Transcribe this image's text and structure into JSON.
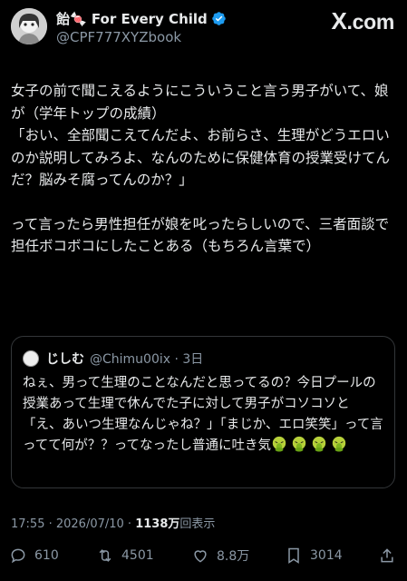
{
  "header": {
    "display_name": "飴🍬 For Every Child",
    "handle": "@CPF777XYZbook",
    "brand": ".com",
    "brand_x": "X"
  },
  "post": {
    "paragraph1": "女子の前で聞こえるようにこういうこと言う男子がいて、娘が（学年トップの成績）\n「おい、全部聞こえてんだよ、お前らさ、生理がどうエロいのか説明してみろよ、なんのために保健体育の授業受けてんだ？脳みそ腐ってんのか？」",
    "paragraph2": "って言ったら男性担任が娘を叱ったらしいので、三者面談で担任ボコボコにしたことある（もちろん言葉で）"
  },
  "quote": {
    "name": "じしむ",
    "meta": "@Chimu00ix · 3日",
    "text": "ねぇ、男って生理のことなんだと思ってるの？今日プールの授業あって生理で休んでた子に対して男子がコソコソと「え、あいつ生理なんじゃね？」「まじか、エロ笑笑」って言ってて何が？？ってなったし普通に吐き気",
    "emoji_name": "vomiting-face-emoji",
    "emoji_count": 4
  },
  "meta": {
    "time_date": "17:55 · 2026/07/10 · ",
    "views": "1138万",
    "views_label": "回表示"
  },
  "actions": {
    "replies": "610",
    "reposts": "4501",
    "likes": "8.8万",
    "bookmarks": "3014"
  },
  "colors": {
    "background": "#000000",
    "text": "#e7e9ea",
    "muted": "#8b98a5",
    "verified": "#1d9bf0",
    "border": "#333639"
  }
}
